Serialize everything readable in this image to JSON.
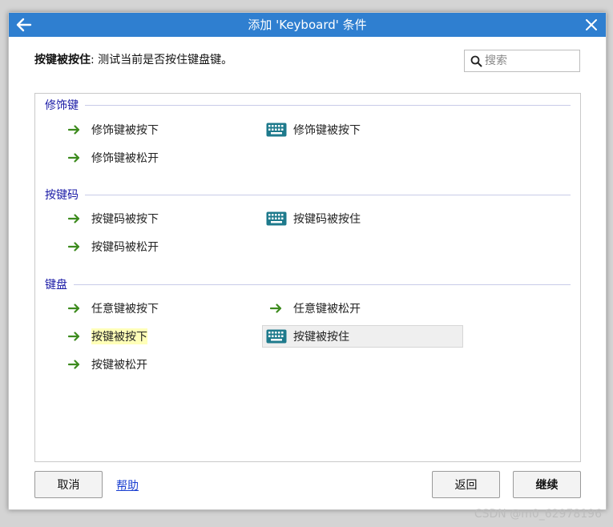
{
  "window": {
    "title": "添加 'Keyboard' 条件"
  },
  "description": {
    "label": "按键被按住",
    "text": ": 测试当前是否按住键盘键。"
  },
  "search": {
    "placeholder": "搜索",
    "value": ""
  },
  "groups": [
    {
      "title": "修饰键",
      "items": [
        {
          "label": "修饰键被按下",
          "icon": "arrow-right-icon"
        },
        {
          "label": "修饰键被按下",
          "icon": "keyboard-icon"
        },
        {
          "label": "修饰键被松开",
          "icon": "arrow-right-icon"
        }
      ]
    },
    {
      "title": "按键码",
      "items": [
        {
          "label": "按键码被按下",
          "icon": "arrow-right-icon"
        },
        {
          "label": "按键码被按住",
          "icon": "keyboard-icon"
        },
        {
          "label": "按键码被松开",
          "icon": "arrow-right-icon"
        }
      ]
    },
    {
      "title": "键盘",
      "items": [
        {
          "label": "任意键被按下",
          "icon": "arrow-right-icon"
        },
        {
          "label": "任意键被松开",
          "icon": "arrow-right-icon"
        },
        {
          "label": "按键被按下",
          "icon": "arrow-right-icon",
          "highlighted": true
        },
        {
          "label": "按键被按住",
          "icon": "keyboard-icon",
          "selected": true
        },
        {
          "label": "按键被松开",
          "icon": "arrow-right-icon"
        }
      ]
    }
  ],
  "footer": {
    "cancel_label": "取消",
    "help_label": "帮助",
    "back_label": "返回",
    "continue_label": "继续"
  },
  "watermark": "CSDN @m0_62978196",
  "colors": {
    "titlebar": "#2f7fd0",
    "group_title": "#1a1aa6",
    "arrow_icon": "#3d8b1e",
    "keyboard_icon": "#1e7a8c",
    "highlight": "#ffffb8",
    "link": "#1a3fd1"
  }
}
